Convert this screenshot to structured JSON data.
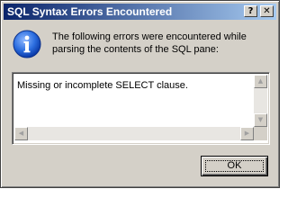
{
  "window": {
    "title": "SQL Syntax Errors Encountered",
    "help_glyph": "?",
    "close_glyph": "✕"
  },
  "message": {
    "icon": "information-icon",
    "line1": "The following errors were encountered while",
    "line2": "parsing the contents of the SQL pane:"
  },
  "errors": {
    "text": "Missing or incomplete SELECT clause."
  },
  "scrollbars": {
    "up_glyph": "▲",
    "down_glyph": "▼",
    "left_glyph": "◀",
    "right_glyph": "▶"
  },
  "buttons": {
    "ok_label": "OK"
  },
  "colors": {
    "title_start": "#0a246a",
    "title_end": "#a6caf0",
    "face": "#d4d0c8",
    "info_icon": "#1f5fd6"
  }
}
